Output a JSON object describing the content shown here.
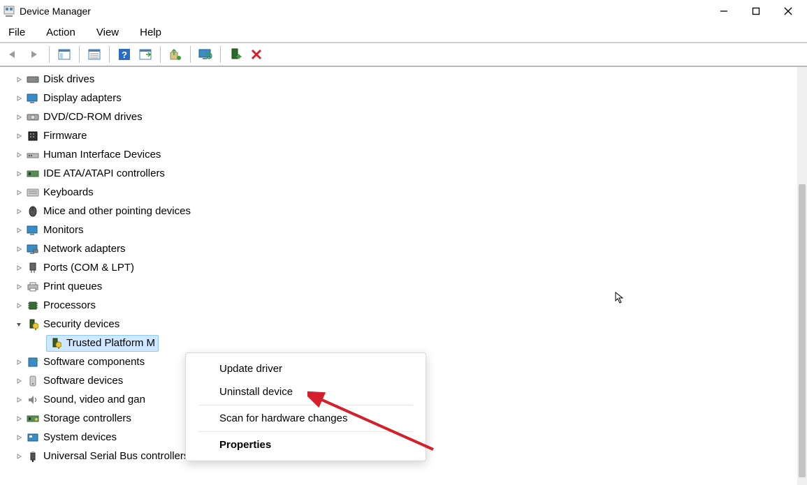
{
  "window": {
    "title": "Device Manager"
  },
  "menu": {
    "items": [
      "File",
      "Action",
      "View",
      "Help"
    ]
  },
  "toolbar": {
    "buttons": [
      {
        "name": "back-icon"
      },
      {
        "name": "forward-icon"
      },
      {
        "sep": true
      },
      {
        "name": "show-hidden-icon"
      },
      {
        "sep": true
      },
      {
        "name": "properties-icon"
      },
      {
        "sep": true
      },
      {
        "name": "help-icon"
      },
      {
        "name": "scan-hardware-icon"
      },
      {
        "sep": true
      },
      {
        "name": "update-driver-icon"
      },
      {
        "sep": true
      },
      {
        "name": "monitor-icon"
      },
      {
        "sep": true
      },
      {
        "name": "enable-device-icon"
      },
      {
        "name": "uninstall-device-icon"
      }
    ]
  },
  "tree": [
    {
      "label": "Disk drives",
      "icon": "disk-icon",
      "expanded": false
    },
    {
      "label": "Display adapters",
      "icon": "display-icon",
      "expanded": false
    },
    {
      "label": "DVD/CD-ROM drives",
      "icon": "dvd-icon",
      "expanded": false
    },
    {
      "label": "Firmware",
      "icon": "firmware-icon",
      "expanded": false
    },
    {
      "label": "Human Interface Devices",
      "icon": "hid-icon",
      "expanded": false
    },
    {
      "label": "IDE ATA/ATAPI controllers",
      "icon": "ide-icon",
      "expanded": false
    },
    {
      "label": "Keyboards",
      "icon": "keyboard-icon",
      "expanded": false
    },
    {
      "label": "Mice and other pointing devices",
      "icon": "mouse-icon",
      "expanded": false
    },
    {
      "label": "Monitors",
      "icon": "monitor-icon",
      "expanded": false
    },
    {
      "label": "Network adapters",
      "icon": "network-icon",
      "expanded": false
    },
    {
      "label": "Ports (COM & LPT)",
      "icon": "port-icon",
      "expanded": false
    },
    {
      "label": "Print queues",
      "icon": "printer-icon",
      "expanded": false
    },
    {
      "label": "Processors",
      "icon": "cpu-icon",
      "expanded": false
    },
    {
      "label": "Security devices",
      "icon": "security-icon",
      "expanded": true,
      "children": [
        {
          "label": "Trusted Platform M",
          "icon": "tpm-icon",
          "selected": true
        }
      ]
    },
    {
      "label": "Software components",
      "icon": "swcomp-icon",
      "expanded": false
    },
    {
      "label": "Software devices",
      "icon": "swdev-icon",
      "expanded": false
    },
    {
      "label": "Sound, video and gan",
      "icon": "sound-icon",
      "expanded": false
    },
    {
      "label": "Storage controllers",
      "icon": "storage-icon",
      "expanded": false
    },
    {
      "label": "System devices",
      "icon": "system-icon",
      "expanded": false
    },
    {
      "label": "Universal Serial Bus controllers",
      "icon": "usb-icon",
      "expanded": false
    }
  ],
  "context_menu": {
    "items": [
      {
        "label": "Update driver"
      },
      {
        "label": "Uninstall device"
      },
      {
        "sep": true
      },
      {
        "label": "Scan for hardware changes"
      },
      {
        "sep": true
      },
      {
        "label": "Properties",
        "bold": true
      }
    ],
    "annotation_target": "Uninstall device"
  }
}
